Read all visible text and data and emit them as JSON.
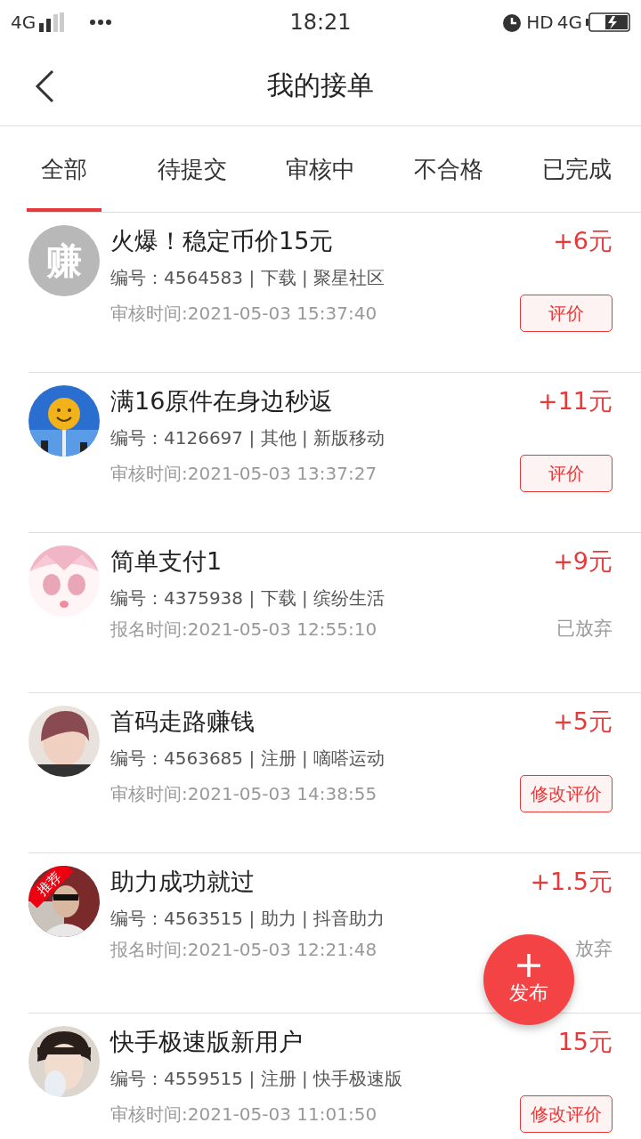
{
  "status_bar": {
    "network_left": "4G",
    "time": "18:21",
    "hd": "HD",
    "network_right": "4G"
  },
  "header": {
    "title": "我的接单"
  },
  "tabs": [
    {
      "label": "全部",
      "selected": true
    },
    {
      "label": "待提交",
      "selected": false
    },
    {
      "label": "审核中",
      "selected": false
    },
    {
      "label": "不合格",
      "selected": false
    },
    {
      "label": "已完成",
      "selected": false
    }
  ],
  "orders": [
    {
      "avatar": {
        "kind": "text",
        "text": "赚"
      },
      "title": "火爆！稳定币价15元",
      "reward": "+6元",
      "meta": "编号：4564583 | 下载 | 聚星社区",
      "time": "审核时间:2021-05-03 15:37:40",
      "action": {
        "kind": "button",
        "text": "评价"
      }
    },
    {
      "title": "满16原件在身边秒返",
      "reward": "+11元",
      "meta": "编号：4126697 | 其他 | 新版移动",
      "time": "审核时间:2021-05-03 13:37:27",
      "action": {
        "kind": "button",
        "text": "评价"
      }
    },
    {
      "title": "简单支付1",
      "reward": "+9元",
      "meta": "编号：4375938 | 下载 | 缤纷生活",
      "time": "报名时间:2021-05-03 12:55:10",
      "action": {
        "kind": "status",
        "text": "已放弃"
      }
    },
    {
      "title": "首码走路赚钱",
      "reward": "+5元",
      "meta": "编号：4563685 | 注册 | 嘀嗒运动",
      "time": "审核时间:2021-05-03 14:38:55",
      "action": {
        "kind": "button",
        "text": "修改评价"
      }
    },
    {
      "avatar": {
        "kind": "picture",
        "ribbon": "推荐"
      },
      "title": "助力成功就过",
      "reward": "+1.5元",
      "meta": "编号：4563515 | 助力 | 抖音助力",
      "time": "报名时间:2021-05-03 12:21:48",
      "action": {
        "kind": "status",
        "text": "放弃"
      }
    },
    {
      "title": "快手极速版新用户",
      "reward": "15元",
      "meta": "编号：4559515 | 注册 | 快手极速版",
      "time": "审核时间:2021-05-03 11:01:50",
      "action": {
        "kind": "button",
        "text": "修改评价"
      }
    }
  ],
  "fab": {
    "label": "发布"
  }
}
